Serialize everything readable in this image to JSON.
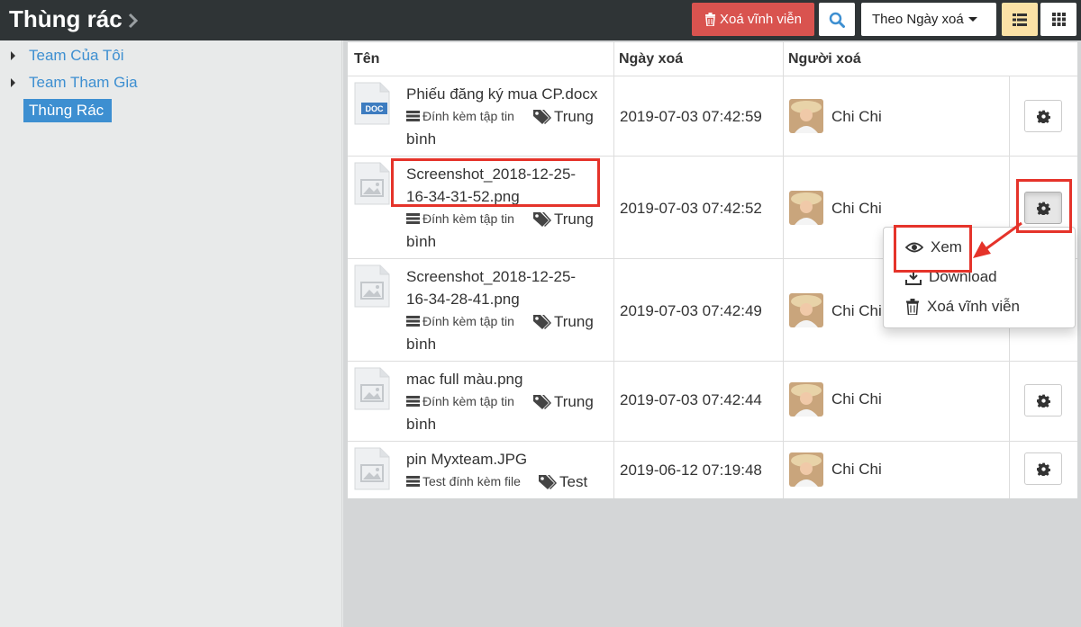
{
  "header": {
    "title": "Thùng rác",
    "delete_all_label": "Xoá vĩnh viễn",
    "sort_label": "Theo Ngày xoá"
  },
  "sidebar": {
    "items": [
      {
        "label": "Team Của Tôi"
      },
      {
        "label": "Team Tham Gia"
      },
      {
        "label": "Thùng Rác"
      }
    ]
  },
  "table": {
    "columns": [
      "Tên",
      "Ngày xoá",
      "Người xoá"
    ],
    "rows": [
      {
        "name_lines": [
          "Phiếu đăng ký mua CP.docx"
        ],
        "meta": "Đính kèm tập tin",
        "tag": "Trung",
        "tag_cont": "bình",
        "date": "2019-07-03 07:42:59",
        "user": "Chi Chi",
        "icon": "doc-file-icon",
        "icon_label": "DOC"
      },
      {
        "name_lines": [
          "Screenshot_2018-12-25-",
          "16-34-31-52.png"
        ],
        "meta": "Đính kèm tập tin",
        "tag": "Trung",
        "tag_cont": "bình",
        "date": "2019-07-03 07:42:52",
        "user": "Chi Chi",
        "icon": "image-file-icon"
      },
      {
        "name_lines": [
          "Screenshot_2018-12-25-",
          "16-34-28-41.png"
        ],
        "meta": "Đính kèm tập tin",
        "tag": "Trung",
        "tag_cont": "bình",
        "date": "2019-07-03 07:42:49",
        "user": "Chi Chi",
        "icon": "image-file-icon"
      },
      {
        "name_lines": [
          "mac full màu.png"
        ],
        "meta": "Đính kèm tập tin",
        "tag": "Trung",
        "tag_cont": "bình",
        "date": "2019-07-03 07:42:44",
        "user": "Chi Chi",
        "icon": "image-file-icon"
      },
      {
        "name_lines": [
          "pin Myxteam.JPG"
        ],
        "meta": "Test đính kèm file",
        "tag": "Test",
        "tag_cont": "",
        "date": "2019-06-12 07:19:48",
        "user": "Chi Chi",
        "icon": "image-file-icon"
      }
    ]
  },
  "dropdown": {
    "items": [
      {
        "label": "Xem",
        "icon": "eye-icon"
      },
      {
        "label": "Download",
        "icon": "download-icon"
      },
      {
        "label": "Xoá vĩnh viễn",
        "icon": "trash-icon"
      }
    ]
  },
  "colors": {
    "topbar": "#2f3436",
    "accent": "#3d8fd1",
    "danger": "#d9534f",
    "annotation": "#e5332a"
  }
}
